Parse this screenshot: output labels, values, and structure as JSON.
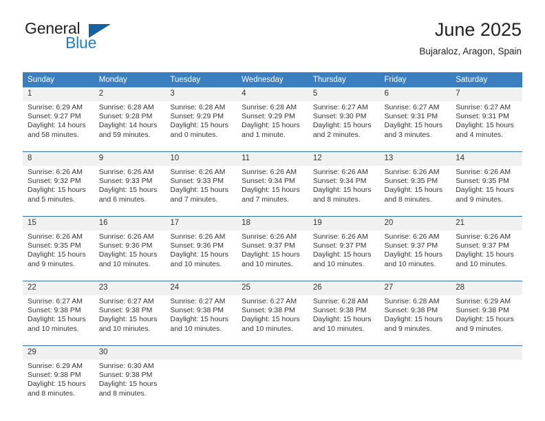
{
  "brand": {
    "name_part1": "General",
    "name_part2": "Blue",
    "flag_icon": "triangle-flag-icon"
  },
  "header": {
    "title": "June 2025",
    "location": "Bujaraloz, Aragon, Spain"
  },
  "colors": {
    "header_blue": "#3c7fc1",
    "row_divider_blue": "#2f6fad",
    "daynum_band": "#f1f1f1",
    "brand_blue": "#1f7ec4",
    "text": "#333333"
  },
  "calendar": {
    "weekday_headers": [
      "Sunday",
      "Monday",
      "Tuesday",
      "Wednesday",
      "Thursday",
      "Friday",
      "Saturday"
    ],
    "weeks": [
      {
        "days": [
          {
            "num": "1",
            "sunrise": "Sunrise: 6:29 AM",
            "sunset": "Sunset: 9:27 PM",
            "daylight": "Daylight: 14 hours and 58 minutes."
          },
          {
            "num": "2",
            "sunrise": "Sunrise: 6:28 AM",
            "sunset": "Sunset: 9:28 PM",
            "daylight": "Daylight: 14 hours and 59 minutes."
          },
          {
            "num": "3",
            "sunrise": "Sunrise: 6:28 AM",
            "sunset": "Sunset: 9:29 PM",
            "daylight": "Daylight: 15 hours and 0 minutes."
          },
          {
            "num": "4",
            "sunrise": "Sunrise: 6:28 AM",
            "sunset": "Sunset: 9:29 PM",
            "daylight": "Daylight: 15 hours and 1 minute."
          },
          {
            "num": "5",
            "sunrise": "Sunrise: 6:27 AM",
            "sunset": "Sunset: 9:30 PM",
            "daylight": "Daylight: 15 hours and 2 minutes."
          },
          {
            "num": "6",
            "sunrise": "Sunrise: 6:27 AM",
            "sunset": "Sunset: 9:31 PM",
            "daylight": "Daylight: 15 hours and 3 minutes."
          },
          {
            "num": "7",
            "sunrise": "Sunrise: 6:27 AM",
            "sunset": "Sunset: 9:31 PM",
            "daylight": "Daylight: 15 hours and 4 minutes."
          }
        ]
      },
      {
        "days": [
          {
            "num": "8",
            "sunrise": "Sunrise: 6:26 AM",
            "sunset": "Sunset: 9:32 PM",
            "daylight": "Daylight: 15 hours and 5 minutes."
          },
          {
            "num": "9",
            "sunrise": "Sunrise: 6:26 AM",
            "sunset": "Sunset: 9:33 PM",
            "daylight": "Daylight: 15 hours and 6 minutes."
          },
          {
            "num": "10",
            "sunrise": "Sunrise: 6:26 AM",
            "sunset": "Sunset: 9:33 PM",
            "daylight": "Daylight: 15 hours and 7 minutes."
          },
          {
            "num": "11",
            "sunrise": "Sunrise: 6:26 AM",
            "sunset": "Sunset: 9:34 PM",
            "daylight": "Daylight: 15 hours and 7 minutes."
          },
          {
            "num": "12",
            "sunrise": "Sunrise: 6:26 AM",
            "sunset": "Sunset: 9:34 PM",
            "daylight": "Daylight: 15 hours and 8 minutes."
          },
          {
            "num": "13",
            "sunrise": "Sunrise: 6:26 AM",
            "sunset": "Sunset: 9:35 PM",
            "daylight": "Daylight: 15 hours and 8 minutes."
          },
          {
            "num": "14",
            "sunrise": "Sunrise: 6:26 AM",
            "sunset": "Sunset: 9:35 PM",
            "daylight": "Daylight: 15 hours and 9 minutes."
          }
        ]
      },
      {
        "days": [
          {
            "num": "15",
            "sunrise": "Sunrise: 6:26 AM",
            "sunset": "Sunset: 9:35 PM",
            "daylight": "Daylight: 15 hours and 9 minutes."
          },
          {
            "num": "16",
            "sunrise": "Sunrise: 6:26 AM",
            "sunset": "Sunset: 9:36 PM",
            "daylight": "Daylight: 15 hours and 10 minutes."
          },
          {
            "num": "17",
            "sunrise": "Sunrise: 6:26 AM",
            "sunset": "Sunset: 9:36 PM",
            "daylight": "Daylight: 15 hours and 10 minutes."
          },
          {
            "num": "18",
            "sunrise": "Sunrise: 6:26 AM",
            "sunset": "Sunset: 9:37 PM",
            "daylight": "Daylight: 15 hours and 10 minutes."
          },
          {
            "num": "19",
            "sunrise": "Sunrise: 6:26 AM",
            "sunset": "Sunset: 9:37 PM",
            "daylight": "Daylight: 15 hours and 10 minutes."
          },
          {
            "num": "20",
            "sunrise": "Sunrise: 6:26 AM",
            "sunset": "Sunset: 9:37 PM",
            "daylight": "Daylight: 15 hours and 10 minutes."
          },
          {
            "num": "21",
            "sunrise": "Sunrise: 6:26 AM",
            "sunset": "Sunset: 9:37 PM",
            "daylight": "Daylight: 15 hours and 10 minutes."
          }
        ]
      },
      {
        "days": [
          {
            "num": "22",
            "sunrise": "Sunrise: 6:27 AM",
            "sunset": "Sunset: 9:38 PM",
            "daylight": "Daylight: 15 hours and 10 minutes."
          },
          {
            "num": "23",
            "sunrise": "Sunrise: 6:27 AM",
            "sunset": "Sunset: 9:38 PM",
            "daylight": "Daylight: 15 hours and 10 minutes."
          },
          {
            "num": "24",
            "sunrise": "Sunrise: 6:27 AM",
            "sunset": "Sunset: 9:38 PM",
            "daylight": "Daylight: 15 hours and 10 minutes."
          },
          {
            "num": "25",
            "sunrise": "Sunrise: 6:27 AM",
            "sunset": "Sunset: 9:38 PM",
            "daylight": "Daylight: 15 hours and 10 minutes."
          },
          {
            "num": "26",
            "sunrise": "Sunrise: 6:28 AM",
            "sunset": "Sunset: 9:38 PM",
            "daylight": "Daylight: 15 hours and 10 minutes."
          },
          {
            "num": "27",
            "sunrise": "Sunrise: 6:28 AM",
            "sunset": "Sunset: 9:38 PM",
            "daylight": "Daylight: 15 hours and 9 minutes."
          },
          {
            "num": "28",
            "sunrise": "Sunrise: 6:29 AM",
            "sunset": "Sunset: 9:38 PM",
            "daylight": "Daylight: 15 hours and 9 minutes."
          }
        ]
      },
      {
        "days": [
          {
            "num": "29",
            "sunrise": "Sunrise: 6:29 AM",
            "sunset": "Sunset: 9:38 PM",
            "daylight": "Daylight: 15 hours and 8 minutes."
          },
          {
            "num": "30",
            "sunrise": "Sunrise: 6:30 AM",
            "sunset": "Sunset: 9:38 PM",
            "daylight": "Daylight: 15 hours and 8 minutes."
          },
          {
            "num": "",
            "sunrise": "",
            "sunset": "",
            "daylight": ""
          },
          {
            "num": "",
            "sunrise": "",
            "sunset": "",
            "daylight": ""
          },
          {
            "num": "",
            "sunrise": "",
            "sunset": "",
            "daylight": ""
          },
          {
            "num": "",
            "sunrise": "",
            "sunset": "",
            "daylight": ""
          },
          {
            "num": "",
            "sunrise": "",
            "sunset": "",
            "daylight": ""
          }
        ]
      }
    ]
  }
}
